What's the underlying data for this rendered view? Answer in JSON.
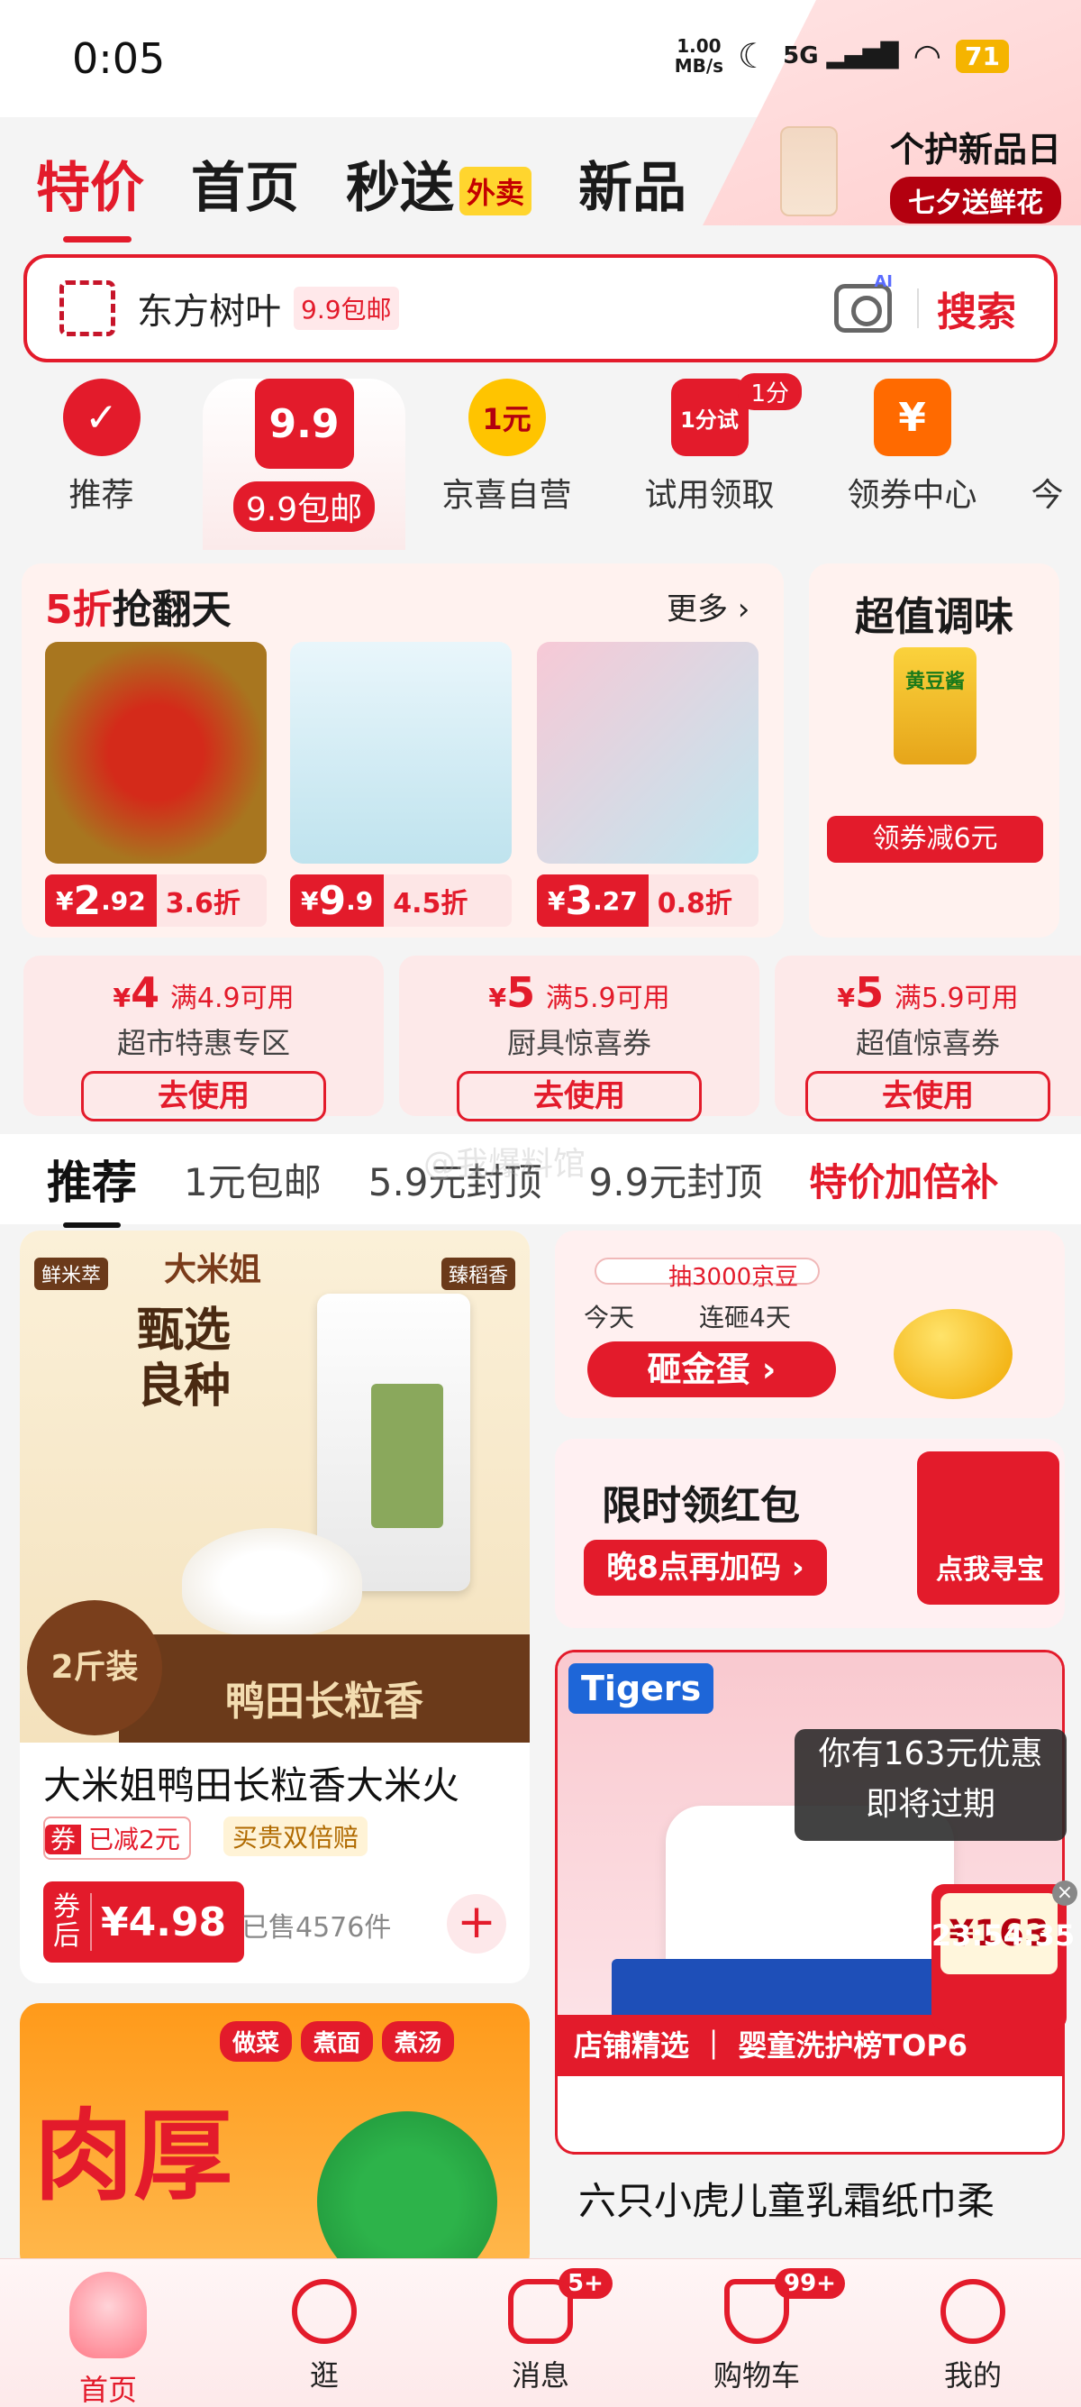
{
  "status_bar": {
    "time": "0:05",
    "net_speed": "1.00",
    "net_unit": "MB/s",
    "signal": "5G",
    "battery": "71"
  },
  "header": {
    "tabs": [
      {
        "label": "特价",
        "active": true
      },
      {
        "label": "首页"
      },
      {
        "label": "秒送",
        "badge": "外卖"
      },
      {
        "label": "新品"
      }
    ],
    "promo": {
      "title": "个护新品日",
      "subtitle": "七夕送鲜花"
    }
  },
  "search": {
    "placeholder": "东方树叶",
    "tag": "9.9包邮",
    "ai_badge": "AI",
    "button": "搜索"
  },
  "categories": [
    {
      "label": "推荐",
      "icon": "check-star-icon"
    },
    {
      "label": "9.9包邮",
      "icon": "9.9",
      "selected": true
    },
    {
      "label": "京喜自营",
      "icon": "1元"
    },
    {
      "label": "试用领取",
      "icon": "1分试",
      "badge": "1分"
    },
    {
      "label": "领券中心",
      "icon": "¥"
    },
    {
      "label": "今"
    }
  ],
  "half_price": {
    "title_highlight": "5折",
    "title_rest": "抢翻天",
    "more": "更多 ›",
    "items": [
      {
        "price_int": "2",
        "price_dec": ".92",
        "discount": "3.6折"
      },
      {
        "price_int": "9",
        "price_dec": ".9",
        "discount": "4.5折"
      },
      {
        "price_int": "3",
        "price_dec": ".27",
        "discount": "0.8折"
      }
    ]
  },
  "seasoning": {
    "title": "超值调味",
    "product": "黄豆酱",
    "button": "领券减6元"
  },
  "coupons": [
    {
      "amount": "4",
      "condition": "满4.9可用",
      "name": "超市特惠专区",
      "button": "去使用"
    },
    {
      "amount": "5",
      "condition": "满5.9可用",
      "name": "厨具惊喜券",
      "button": "去使用"
    },
    {
      "amount": "5",
      "condition": "满5.9可用",
      "name": "超值惊喜券",
      "button": "去使用"
    }
  ],
  "feed_tabs": [
    {
      "label": "推荐",
      "active": true
    },
    {
      "label": "1元包邮"
    },
    {
      "label": "5.9元封顶"
    },
    {
      "label": "9.9元封顶"
    },
    {
      "label": "特价加倍补",
      "highlight": true
    }
  ],
  "watermark": "@我爆料馆",
  "products_left": [
    {
      "image_text": {
        "brand": "大米姐",
        "tag1": "鲜米萃",
        "tag2": "臻稻香",
        "headline": "甄选\n良种",
        "weight": "2斤装",
        "banner": "鸭田长粒香"
      },
      "title": "大米姐鸭田长粒香大米火",
      "tag_coupon_prefix": "券",
      "tag_coupon": "已减2元",
      "tag_gold": "买贵双倍赔",
      "price_prefix": "券后",
      "price": "¥4.98",
      "sold": "已售4576件",
      "add": "+"
    },
    {
      "image_text": {
        "tags": [
          "做菜",
          "煮面",
          "煮汤"
        ],
        "headline": "肉厚"
      }
    }
  ],
  "egg_card": {
    "progress_label": "抽3000京豆",
    "day_today": "今天",
    "day_streak": "连砸4天",
    "button": "砸金蛋 ›"
  },
  "red_packet_card": {
    "title": "限时领红包",
    "button": "晚8点再加码 ›",
    "gift_label": "点我寻宝"
  },
  "product_right": {
    "brand": "Tigers",
    "strip_label": "店铺精选",
    "strip_rank": "婴童洗护榜TOP6",
    "title": "六只小虎儿童乳霜纸巾柔"
  },
  "tooltip": {
    "line1": "你有163元优惠",
    "line2": "即将过期"
  },
  "float_coupon": {
    "amount": "¥163",
    "countdown": "23:54:35",
    "close": "×"
  },
  "bottom_nav": [
    {
      "label": "首页",
      "active": true
    },
    {
      "label": "逛"
    },
    {
      "label": "消息",
      "badge": "5+"
    },
    {
      "label": "购物车",
      "badge": "99+"
    },
    {
      "label": "我的"
    }
  ],
  "colors": {
    "accent": "#e31b2b",
    "background": "#f4f4f4",
    "gold": "#ffd52e"
  }
}
